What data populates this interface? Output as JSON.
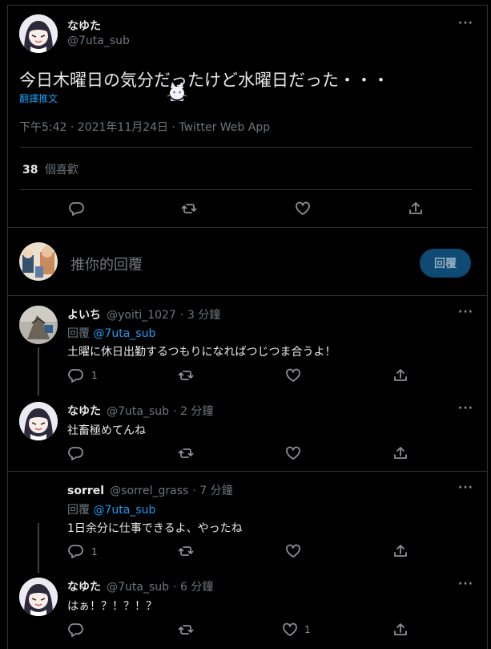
{
  "main_tweet": {
    "display_name": "なゆた",
    "handle": "@7uta_sub",
    "text": "今日木曜日の気分だったけど水曜日だった・・・",
    "translate": "翻譯推文",
    "timestamp": "下午5:42 · 2021年11月24日 · Twitter Web App",
    "likes_count": "38",
    "likes_label": "個喜歡",
    "more": "···"
  },
  "reply_box": {
    "placeholder": "推你的回覆",
    "button": "回覆"
  },
  "replies": [
    {
      "display_name": "よいち",
      "handle": "@yoiti_1027",
      "time": "· 3 分鐘",
      "reply_to_prefix": "回覆",
      "reply_to": "@7uta_sub",
      "text": "土曜に休日出勤するつもりになればつじつま合うよ！",
      "reply_count": "1",
      "like_count": ""
    },
    {
      "display_name": "なゆた",
      "handle": "@7uta_sub",
      "time": "· 2 分鐘",
      "text": "社畜極めてんね",
      "reply_count": "",
      "like_count": ""
    },
    {
      "display_name": "sorrel",
      "handle": "@sorrel_grass",
      "time": "· 7 分鐘",
      "reply_to_prefix": "回覆",
      "reply_to": "@7uta_sub",
      "text": "1日余分に仕事できるよ、やったね",
      "reply_count": "1",
      "like_count": ""
    },
    {
      "display_name": "なゆた",
      "handle": "@7uta_sub",
      "time": "· 6 分鐘",
      "text": "はぁ！？！？！？",
      "reply_count": "",
      "like_count": "1"
    }
  ]
}
